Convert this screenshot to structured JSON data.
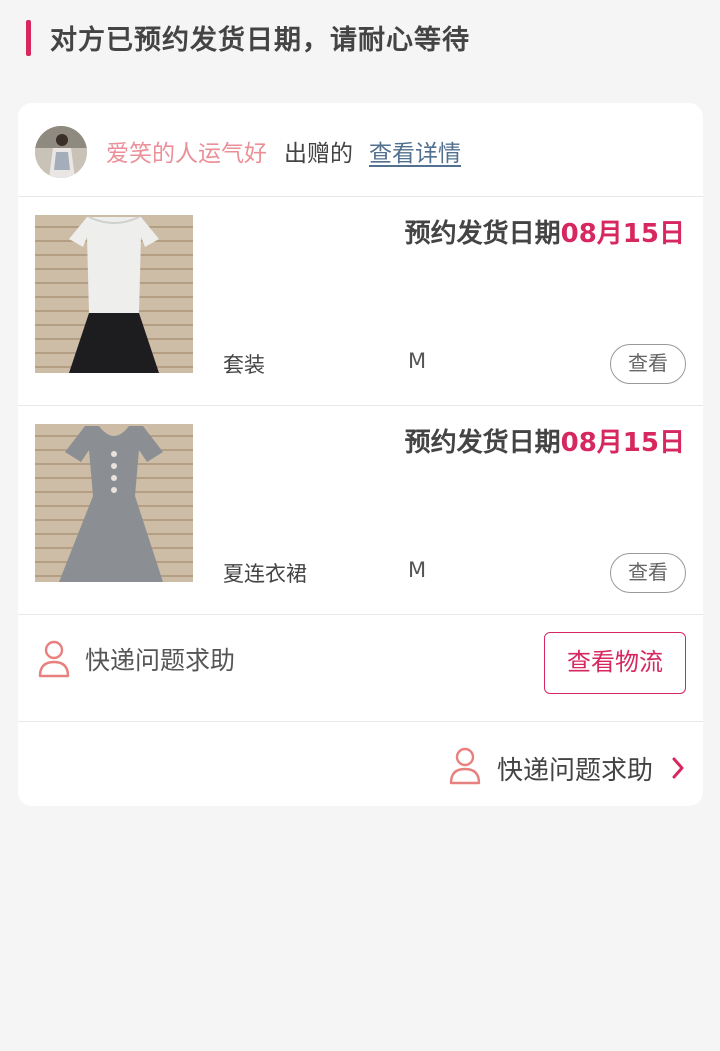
{
  "header": {
    "status_title": "对方已预约发货日期，请耐心等待"
  },
  "giver": {
    "name": "爱笑的人运气好",
    "suffix": "出赠的",
    "detail_link": "查看详情"
  },
  "items": [
    {
      "ship_label": "预约发货日期",
      "ship_date": "08月15日",
      "name": "套装",
      "size": "M",
      "view_label": "查看"
    },
    {
      "ship_label": "预约发货日期",
      "ship_date": "08月15日",
      "name": "夏连衣裙",
      "size": "M",
      "view_label": "查看"
    }
  ],
  "help_row": {
    "label": "快递问题求助",
    "logistics_button": "查看物流"
  },
  "bottom_help": {
    "label": "快递问题求助"
  },
  "colors": {
    "accent": "#d6275f",
    "giver_name": "#eb8f98",
    "link": "#52708f"
  },
  "icons": {
    "help": "person-icon",
    "more": "chevron-right-icon"
  }
}
